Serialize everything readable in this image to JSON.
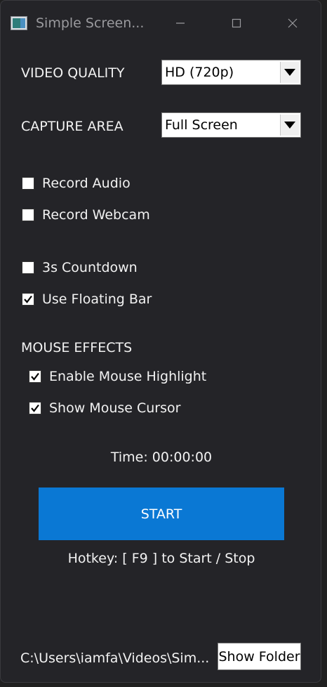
{
  "window": {
    "title": "Simple Screen...",
    "app_icon": "app-icon",
    "controls": {
      "minimize_icon": "minimize-icon",
      "maximize_icon": "maximize-icon",
      "close_icon": "close-icon"
    }
  },
  "video_quality": {
    "label": "VIDEO QUALITY",
    "selected": "HD (720p)"
  },
  "capture_area": {
    "label": "CAPTURE AREA",
    "selected": "Full Screen"
  },
  "options": {
    "record_audio": {
      "label": "Record Audio",
      "checked": false
    },
    "record_webcam": {
      "label": "Record Webcam",
      "checked": false
    },
    "countdown": {
      "label": "3s Countdown",
      "checked": false
    },
    "floating_bar": {
      "label": "Use Floating Bar",
      "checked": true
    }
  },
  "mouse_effects": {
    "heading": "MOUSE EFFECTS",
    "highlight": {
      "label": "Enable Mouse Highlight",
      "checked": true
    },
    "cursor": {
      "label": "Show Mouse Cursor",
      "checked": true
    }
  },
  "timer": {
    "text": "Time: 00:00:00"
  },
  "start_button": {
    "label": "START"
  },
  "hotkey": {
    "text": "Hotkey: [ F9 ] to Start / Stop"
  },
  "footer": {
    "path": "C:\\Users\\iamfa\\Videos\\Sim...",
    "show_folder_label": "Show Folder"
  },
  "colors": {
    "accent": "#0a78d4",
    "background": "#242428",
    "text": "#f2f2f2"
  }
}
